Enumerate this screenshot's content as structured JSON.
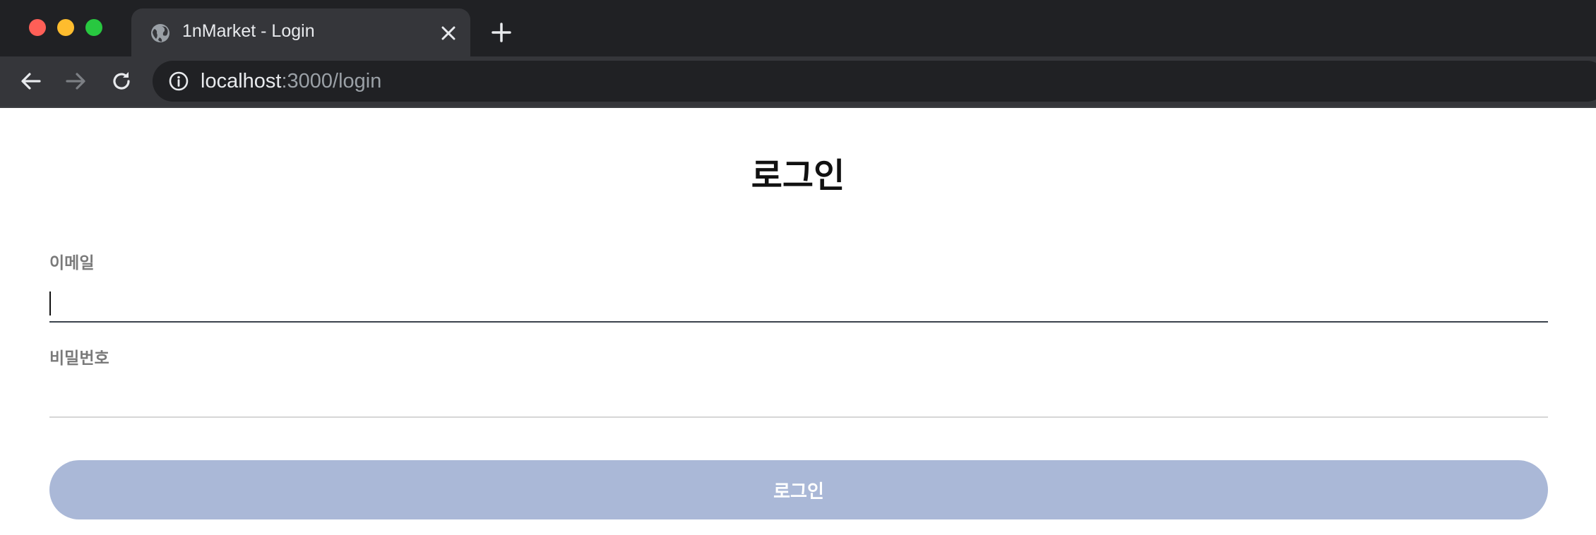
{
  "browser": {
    "tab_title": "1nMarket - Login",
    "url_host": "localhost",
    "url_path": ":3000/login",
    "icons": {
      "tab_favicon": "globe-icon",
      "tab_close": "close-icon",
      "new_tab": "plus-icon",
      "back": "arrow-left-icon",
      "forward": "arrow-right-icon",
      "reload": "reload-icon",
      "site_info": "info-icon"
    },
    "colors": {
      "chrome_bg": "#202124",
      "toolbar_bg": "#35363a",
      "traffic_red": "#ff5f57",
      "traffic_yellow": "#febc2e",
      "traffic_green": "#28c840"
    }
  },
  "login": {
    "title": "로그인",
    "email_label": "이메일",
    "email_value": "",
    "password_label": "비밀번호",
    "password_value": "",
    "submit_label": "로그인",
    "colors": {
      "button_bg": "#aab8d7",
      "button_text": "#ffffff",
      "label_text": "#7a7a7a",
      "active_underline": "#3b434c",
      "inactive_underline": "#d6d6d6"
    }
  }
}
